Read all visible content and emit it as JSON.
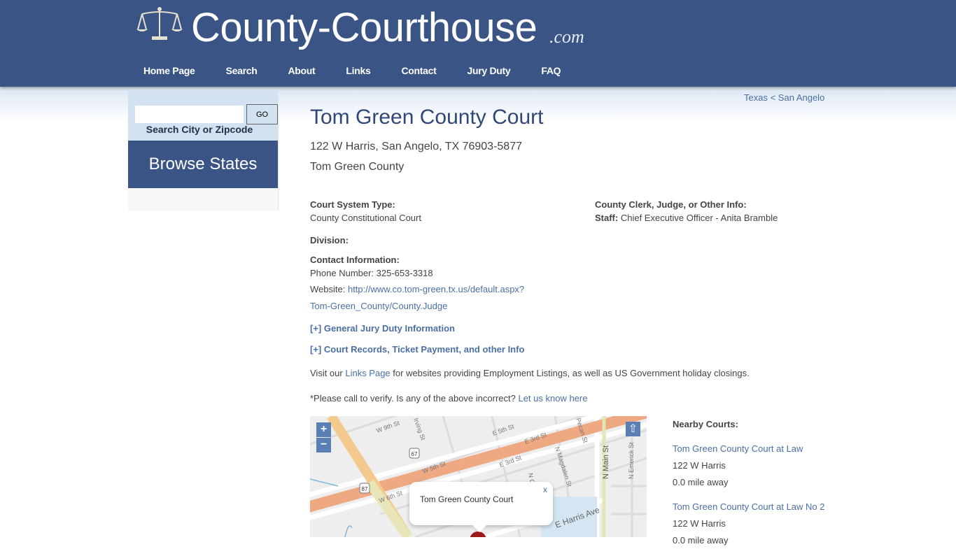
{
  "site": {
    "logo_text": "County-Courthouse",
    "logo_suffix": ".com",
    "logo_icon": "scales-of-justice-icon",
    "nav": [
      {
        "label": "Home Page"
      },
      {
        "label": "Search"
      },
      {
        "label": "About"
      },
      {
        "label": "Links"
      },
      {
        "label": "Contact"
      },
      {
        "label": "Jury Duty"
      },
      {
        "label": "FAQ"
      }
    ]
  },
  "sidebar": {
    "search_value": "",
    "search_placeholder": "",
    "go_label": "GO",
    "search_label": "Search City or Zipcode",
    "browse_label": "Browse States"
  },
  "breadcrumb": {
    "state": "Texas",
    "separator": " < ",
    "city": "San Angelo"
  },
  "court": {
    "title": "Tom Green County Court",
    "address": "122 W Harris, San Angelo, TX 76903-5877",
    "county": "Tom Green County",
    "system_type_label": "Court System Type:",
    "system_type_value": "County Constitutional Court",
    "clerk_label": "County Clerk, Judge, or Other Info:",
    "staff_label": "Staff:",
    "staff_value": "Chief Executive Officer - Anita Bramble",
    "division_label": "Division:",
    "contact_label": "Contact Information:",
    "phone_text": "Phone Number: 325-653-3318",
    "website_label": "Website:",
    "website_line1": "http://www.co.tom-green.tx.us/default.aspx?",
    "website_line2": "Tom-Green_County/County.Judge",
    "jury_toggle": "[+] General Jury Duty Information",
    "records_toggle": "[+] Court Records, Ticket Payment, and other Info",
    "visit_pre": "Visit our ",
    "visit_link": "Links Page",
    "visit_post": " for websites providing Employment Listings, as well as US Government holiday closings.",
    "verify_text": "*Please call to verify. Is any of the above incorrect? ",
    "verify_link": "Let us know here"
  },
  "map": {
    "zoom_in": "+",
    "zoom_out": "−",
    "up_icon": "⇧",
    "popup_text": "Tom Green County Court",
    "popup_close": "x",
    "street_labels": [
      "W 9th St",
      "Irving St",
      "W 5th St",
      "W 6th St",
      "E 5th St",
      "E 3rd St",
      "E 3rd St",
      "N Magdalen St",
      "Pecan St",
      "N Main St",
      "N Emerick St",
      "E Harris Ave",
      "N Ch"
    ],
    "route_shields": [
      "67",
      "87"
    ]
  },
  "nearby": {
    "title": "Nearby Courts:",
    "items": [
      {
        "name": "Tom Green County Court at Law",
        "address": "122 W Harris",
        "distance": "0.0 mile away"
      },
      {
        "name": "Tom Green County Court at Law No 2",
        "address": "122 W Harris",
        "distance": "0.0 mile away"
      }
    ]
  },
  "colors": {
    "header_bg": "#3a5485",
    "link": "#4a6fa5",
    "title": "#2f4779"
  }
}
